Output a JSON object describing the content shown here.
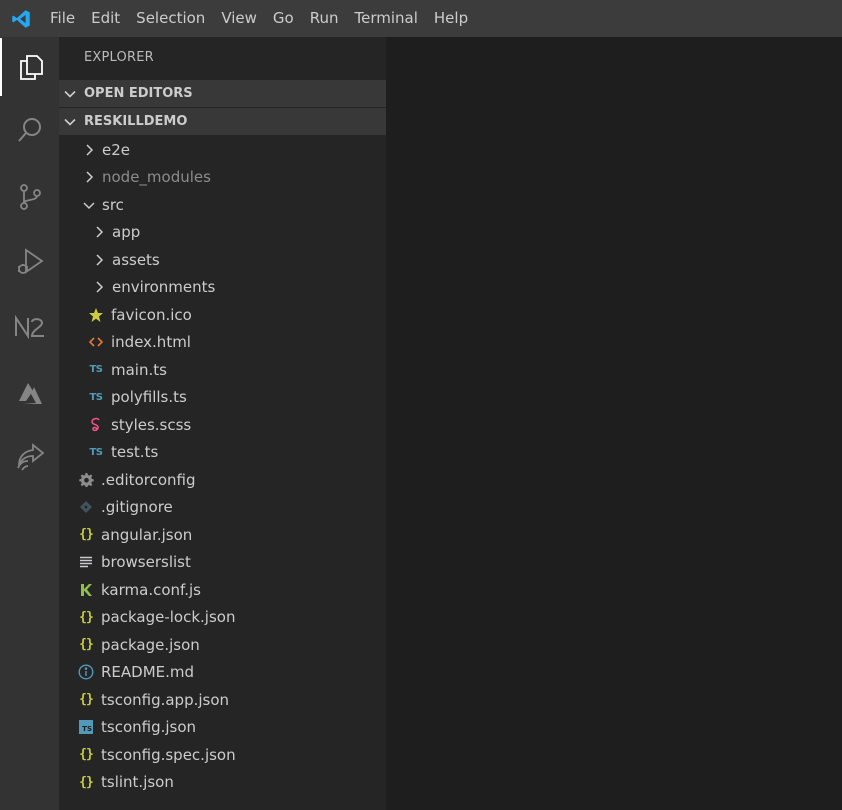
{
  "menubar": {
    "items": [
      "File",
      "Edit",
      "Selection",
      "View",
      "Go",
      "Run",
      "Terminal",
      "Help"
    ]
  },
  "activitybar": {
    "items": [
      "explorer-icon",
      "search-icon",
      "source-control-icon",
      "run-debug-icon",
      "nx-console-icon",
      "azure-icon",
      "live-share-icon"
    ]
  },
  "sidebar": {
    "title": "EXPLORER",
    "open_editors": "OPEN EDITORS",
    "project": "RESKILLDEMO"
  },
  "tree": [
    {
      "label": "e2e",
      "icon": "chevron-right-icon",
      "depth": 1
    },
    {
      "label": "node_modules",
      "icon": "chevron-right-icon",
      "depth": 1,
      "dim": true
    },
    {
      "label": "src",
      "icon": "chevron-down-icon",
      "depth": 1
    },
    {
      "label": "app",
      "icon": "chevron-right-icon",
      "depth": 2
    },
    {
      "label": "assets",
      "icon": "chevron-right-icon",
      "depth": 2
    },
    {
      "label": "environments",
      "icon": "chevron-right-icon",
      "depth": 2
    },
    {
      "label": "favicon.ico",
      "icon": "star-icon",
      "depth": 2
    },
    {
      "label": "index.html",
      "icon": "html-icon",
      "depth": 2
    },
    {
      "label": "main.ts",
      "icon": "typescript-icon",
      "depth": 2
    },
    {
      "label": "polyfills.ts",
      "icon": "typescript-icon",
      "depth": 2
    },
    {
      "label": "styles.scss",
      "icon": "sass-icon",
      "depth": 2
    },
    {
      "label": "test.ts",
      "icon": "typescript-icon",
      "depth": 2
    },
    {
      "label": ".editorconfig",
      "icon": "gear-icon",
      "depth": 1
    },
    {
      "label": ".gitignore",
      "icon": "git-icon",
      "depth": 1
    },
    {
      "label": "angular.json",
      "icon": "json-icon",
      "depth": 1
    },
    {
      "label": "browserslist",
      "icon": "lines-icon",
      "depth": 1
    },
    {
      "label": "karma.conf.js",
      "icon": "karma-icon",
      "depth": 1
    },
    {
      "label": "package-lock.json",
      "icon": "json-icon",
      "depth": 1
    },
    {
      "label": "package.json",
      "icon": "json-icon",
      "depth": 1
    },
    {
      "label": "README.md",
      "icon": "info-icon",
      "depth": 1
    },
    {
      "label": "tsconfig.app.json",
      "icon": "json-icon",
      "depth": 1
    },
    {
      "label": "tsconfig.json",
      "icon": "tsconfig-icon",
      "depth": 1
    },
    {
      "label": "tsconfig.spec.json",
      "icon": "json-icon",
      "depth": 1
    },
    {
      "label": "tslint.json",
      "icon": "json-icon",
      "depth": 1
    }
  ],
  "badges": {
    "ts": "TS",
    "json": "{}"
  }
}
